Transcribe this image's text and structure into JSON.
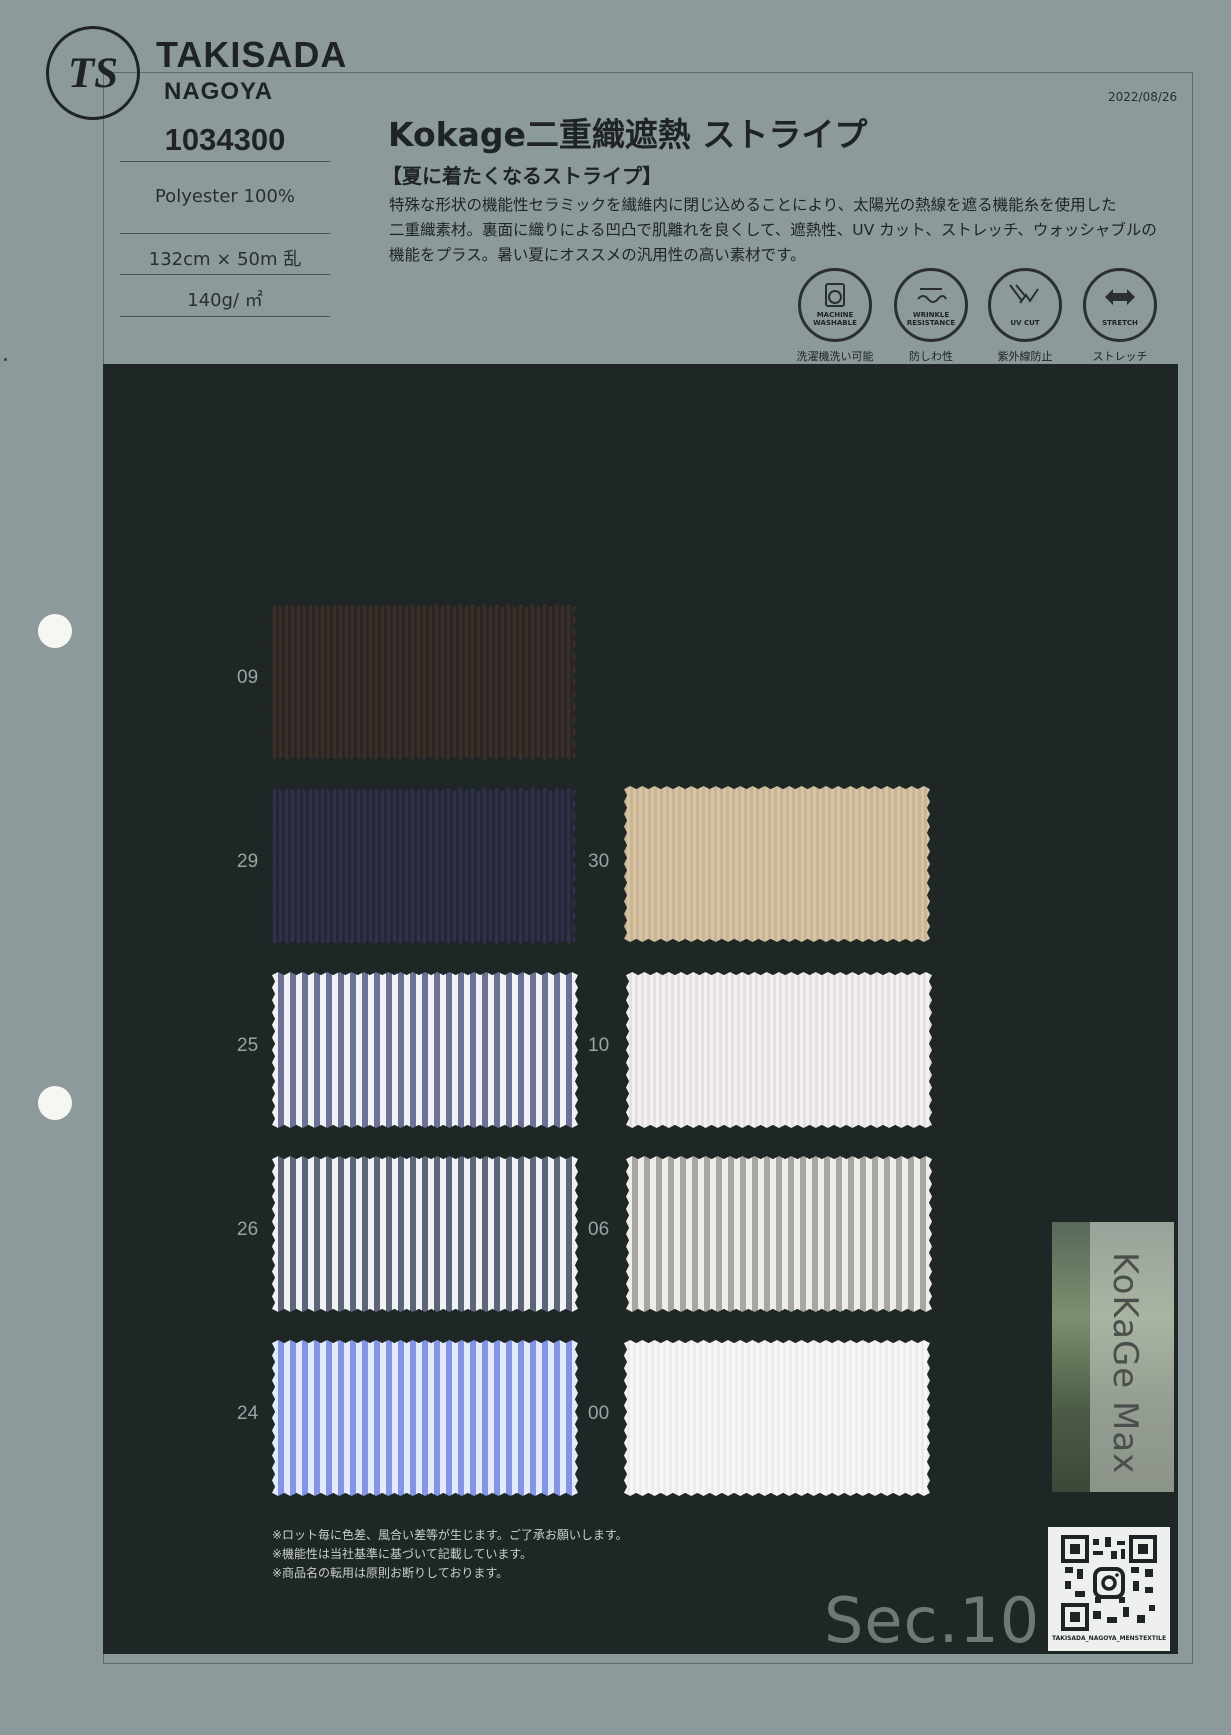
{
  "brand": {
    "name": "TAKISADA",
    "city": "NAGOYA",
    "logo_letters": "TS"
  },
  "product": {
    "code": "1034300",
    "composition": "Polyester 100%",
    "size": "132cm × 50m 乱",
    "weight": "140g/ ㎡"
  },
  "date": "2022/08/26",
  "title": "Kokage二重織遮熱 ストライプ",
  "tagline": "【夏に着たくなるストライプ】",
  "description": [
    "特殊な形状の機能性セラミックを繊維内に閉じ込めることにより、太陽光の熱線を遮る機能糸を使用した",
    "二重織素材。裏面に織りによる凹凸で肌離れを良くして、遮熱性、UV カット、ストレッチ、ウォッシャブルの",
    "機能をプラス。暑い夏にオススメの汎用性の高い素材です。"
  ],
  "features": [
    {
      "icon": "washing-machine-icon",
      "badge": "MACHINE WASHABLE",
      "caption": "洗濯機洗い可能"
    },
    {
      "icon": "wrinkle-resistance-icon",
      "badge": "WRINKLE RESISTANCE",
      "caption": "防しわ性"
    },
    {
      "icon": "uv-cut-icon",
      "badge": "UV CUT",
      "caption": "紫外線防止"
    },
    {
      "icon": "stretch-icon",
      "badge": "STRETCH",
      "caption": "ストレッチ"
    }
  ],
  "swatches": [
    {
      "code": "09",
      "base": "#2c2522",
      "stripe": "#3a302b",
      "pattern": "fine"
    },
    {
      "code": "29",
      "base": "#252638",
      "stripe": "#30324a",
      "pattern": "fine"
    },
    {
      "code": "30",
      "base": "#c9b594",
      "stripe": "#d6c4a5",
      "pattern": "fine"
    },
    {
      "code": "25",
      "base": "#f1f2f6",
      "stripe": "#6c7296",
      "pattern": "bold"
    },
    {
      "code": "10",
      "base": "#f4f1f3",
      "stripe": "#e7dfe6",
      "pattern": "fine"
    },
    {
      "code": "26",
      "base": "#f0f2f5",
      "stripe": "#5d6578",
      "pattern": "bold"
    },
    {
      "code": "06",
      "base": "#eeede9",
      "stripe": "#a7a7a2",
      "pattern": "bold"
    },
    {
      "code": "24",
      "base": "#e4e9fb",
      "stripe": "#8396e6",
      "pattern": "bold"
    },
    {
      "code": "00",
      "base": "#f7f7f7",
      "stripe": "#ececec",
      "pattern": "fine"
    }
  ],
  "notes": [
    "※ロット毎に色差、風合い差等が生じます。ご了承お願いします。",
    "※機能性は当社基準に基づいて記載しています。",
    "※商品名の転用は原則お断りしております。"
  ],
  "section": "Sec.10",
  "kokage_card": {
    "text": "KoKaGe Max"
  },
  "qr": {
    "caption": "TAKISADA_NAGOYA_MENSTEXTILE"
  }
}
